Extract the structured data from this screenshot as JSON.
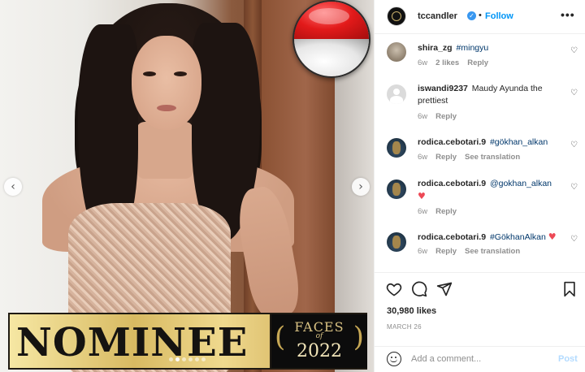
{
  "post": {
    "username": "tccandler",
    "follow_label": "Follow",
    "separator": "•",
    "more_label": "•••",
    "verified_glyph": "✓",
    "likes": "30,980 likes",
    "date": "MARCH 26"
  },
  "image": {
    "banner_text": "NOMINEE",
    "badge_title": "FACES",
    "badge_of": "of",
    "badge_year": "2022",
    "prev_glyph": "‹",
    "next_glyph": "›",
    "flag_colors": [
      "#e21a1a",
      "#ffffff"
    ]
  },
  "comments": [
    {
      "user": "shira_zg",
      "tag": "#mingyu",
      "text": "",
      "age": "6w",
      "likes": "2 likes",
      "reply": "Reply",
      "see_translation": ""
    },
    {
      "user": "iswandi9237",
      "tag": "",
      "text": "Maudy Ayunda the prettiest",
      "age": "6w",
      "likes": "",
      "reply": "Reply",
      "see_translation": ""
    },
    {
      "user": "rodica.cebotari.9",
      "tag": "#gökhan_alkan",
      "text": "",
      "age": "6w",
      "likes": "",
      "reply": "Reply",
      "see_translation": "See translation"
    },
    {
      "user": "rodica.cebotari.9",
      "tag": "@gokhan_alkan",
      "text": "",
      "age": "6w",
      "likes": "",
      "reply": "Reply",
      "see_translation": ""
    },
    {
      "user": "rodica.cebotari.9",
      "tag": "#GökhanAlkan",
      "text": "",
      "age": "6w",
      "likes": "",
      "reply": "Reply",
      "see_translation": "See translation"
    }
  ],
  "add_comment": {
    "placeholder": "Add a comment...",
    "post_label": "Post"
  },
  "icons": {
    "like": "heart-outline-icon",
    "comment": "comment-bubble-icon",
    "share": "paper-plane-icon",
    "save": "bookmark-icon",
    "emoji": "emoji-smile-icon",
    "comment_like": "small-heart-icon"
  },
  "colors": {
    "accent": "#0095f6",
    "verified": "#3897f0",
    "heart_red": "#ed4956"
  }
}
